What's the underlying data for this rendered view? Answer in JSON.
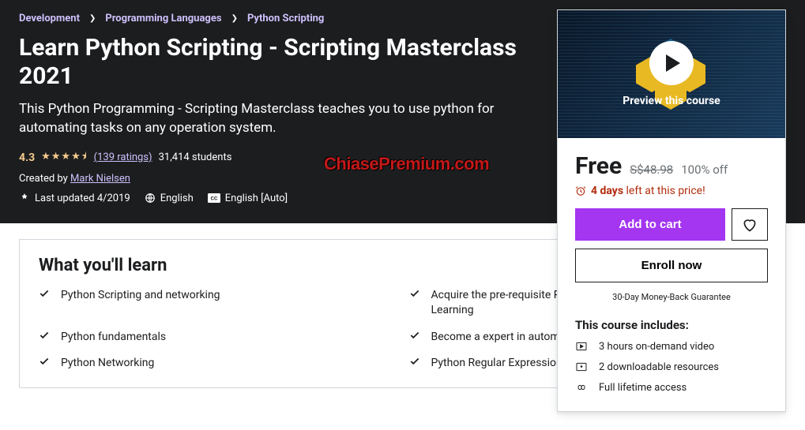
{
  "breadcrumb": [
    "Development",
    "Programming Languages",
    "Python Scripting"
  ],
  "title": "Learn Python Scripting - Scripting Masterclass 2021",
  "subtitle": "This Python Programming - Scripting Masterclass teaches you to use python for automating tasks on any operation system.",
  "rating": {
    "value": "4.3",
    "count_label": "(139 ratings)",
    "students": "31,414 students"
  },
  "creator": {
    "prefix": "Created by ",
    "name": "Mark Nielsen"
  },
  "meta": {
    "updated": "Last updated 4/2019",
    "language": "English",
    "captions": "English [Auto]"
  },
  "watermark": "ChiasePremium.com",
  "learn": {
    "heading": "What you'll learn",
    "items_left": [
      "Python Scripting and networking",
      "Python fundamentals",
      "Python Networking"
    ],
    "items_right": [
      "Acquire the pre-requisite Python skills to move into Machine Learning",
      "Become a expert in automating task on multiple Operating systems",
      "Python Regular Expression"
    ]
  },
  "sidebar": {
    "preview_label": "Preview this course",
    "price": "Free",
    "old_price": "S$48.98",
    "discount": "100% off",
    "timer_bold": "4 days",
    "timer_rest": " left at this price!",
    "add_to_cart": "Add to cart",
    "enroll": "Enroll now",
    "guarantee": "30-Day Money-Back Guarantee",
    "includes_heading": "This course includes:",
    "includes": [
      "3 hours on-demand video",
      "2 downloadable resources",
      "Full lifetime access"
    ]
  }
}
